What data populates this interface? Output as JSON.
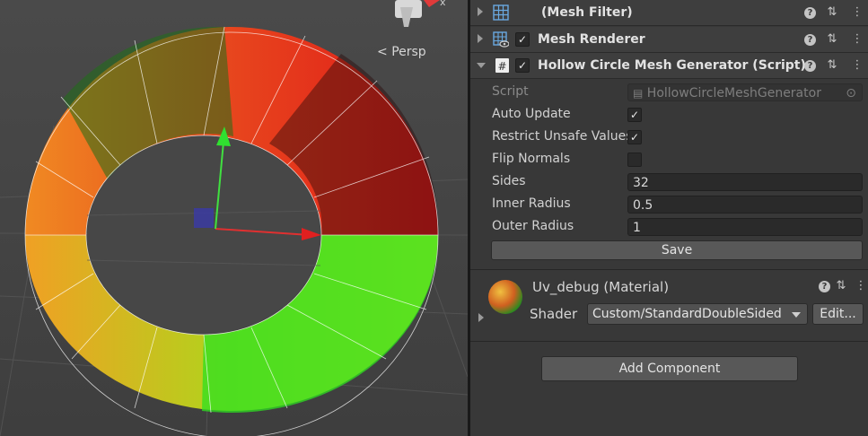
{
  "scene": {
    "camera_label": "Persp",
    "gizmo_axis_label": "x"
  },
  "inspector": {
    "components": [
      {
        "title": "(Mesh Filter)",
        "enabled": true
      },
      {
        "title": "Mesh Renderer",
        "enabled": true
      },
      {
        "title": "Hollow Circle Mesh Generator (Script)",
        "enabled": true
      }
    ],
    "script_props": {
      "script_label": "Script",
      "script_value": "HollowCircleMeshGenerator",
      "auto_update_label": "Auto Update",
      "auto_update": true,
      "restrict_label": "Restrict Unsafe Values",
      "restrict": true,
      "flip_label": "Flip Normals",
      "flip": false,
      "sides_label": "Sides",
      "sides": "32",
      "inner_label": "Inner Radius",
      "inner": "0.5",
      "outer_label": "Outer Radius",
      "outer": "1",
      "save_label": "Save"
    },
    "material": {
      "name": "Uv_debug (Material)",
      "shader_label": "Shader",
      "shader_value": "Custom/StandardDoubleSided",
      "edit_label": "Edit..."
    },
    "add_component_label": "Add Component",
    "check_glyph": "✓",
    "help_glyph": "?",
    "settings_glyph": "⇅",
    "menu_glyph": "⋮"
  },
  "colors": {
    "ring_top": "#e4221c",
    "ring_left": "#f07a1e",
    "ring_right_green": "#22e020",
    "ring_yellow": "#e6e620",
    "dark_green": "#1f6f18"
  }
}
